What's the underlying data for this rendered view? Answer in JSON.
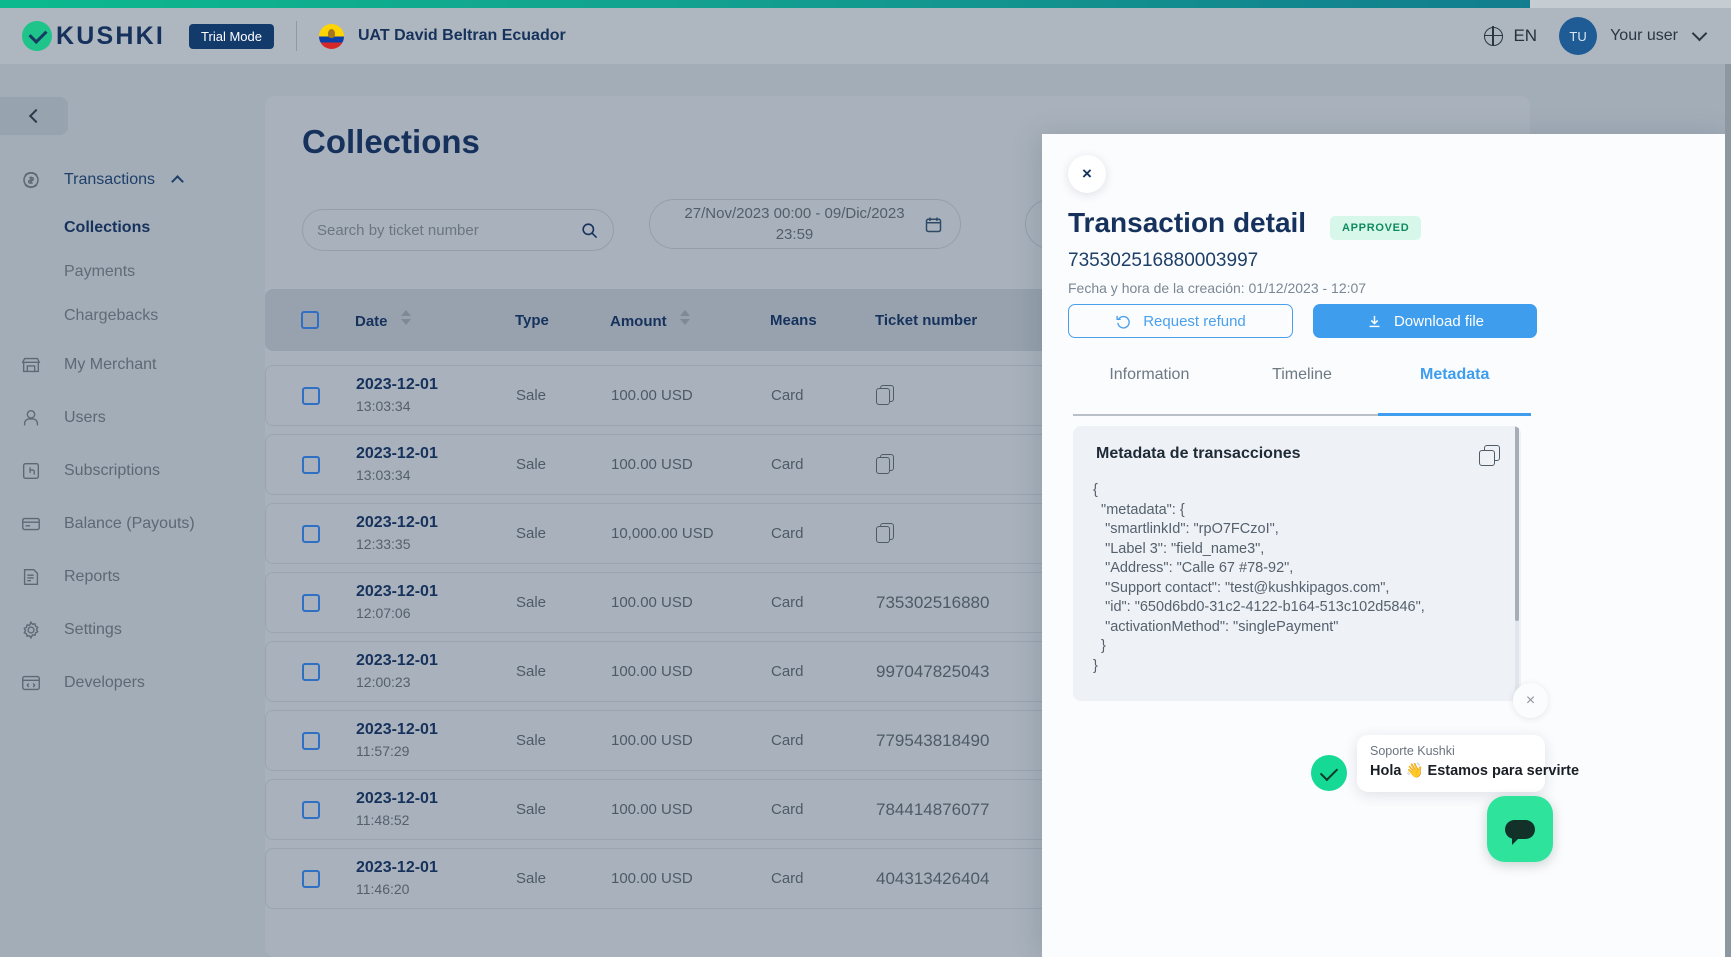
{
  "header": {
    "brand": "KUSHKI",
    "trial_badge": "Trial Mode",
    "merchant": "UAT David Beltran Ecuador",
    "language": "EN",
    "avatar_initials": "TU",
    "username": "Your user",
    "icons": {
      "globe": "globe-icon",
      "chevron": "chevron-down-icon"
    }
  },
  "sidebar": {
    "collapse": "collapse-sidebar",
    "items": [
      {
        "label": "Transactions",
        "icon": "dollar-refresh-icon",
        "expanded": true
      },
      {
        "label": "Collections",
        "sub": true,
        "active": true
      },
      {
        "label": "Payments",
        "sub": true,
        "active": false
      },
      {
        "label": "Chargebacks",
        "sub": true,
        "active": false
      },
      {
        "label": "My Merchant",
        "icon": "store-icon"
      },
      {
        "label": "Users",
        "icon": "user-icon"
      },
      {
        "label": "Subscriptions",
        "icon": "click-icon"
      },
      {
        "label": "Balance (Payouts)",
        "icon": "card-icon"
      },
      {
        "label": "Reports",
        "icon": "report-icon"
      },
      {
        "label": "Settings",
        "icon": "gear-icon"
      },
      {
        "label": "Developers",
        "icon": "code-icon"
      }
    ]
  },
  "page": {
    "title": "Collections",
    "search_placeholder": "Search by ticket number",
    "date_range": "27/Nov/2023 00:00 - 09/Dic/2023 23:59"
  },
  "table": {
    "columns": [
      "Date",
      "Type",
      "Amount",
      "Means",
      "Ticket number"
    ],
    "rows": [
      {
        "date": "2023-12-01",
        "time": "13:03:34",
        "type": "Sale",
        "amount": "100.00 USD",
        "means": "Card",
        "ticket": "",
        "copy": true
      },
      {
        "date": "2023-12-01",
        "time": "13:03:34",
        "type": "Sale",
        "amount": "100.00 USD",
        "means": "Card",
        "ticket": "",
        "copy": true
      },
      {
        "date": "2023-12-01",
        "time": "12:33:35",
        "type": "Sale",
        "amount": "10,000.00 USD",
        "means": "Card",
        "ticket": "",
        "copy": true
      },
      {
        "date": "2023-12-01",
        "time": "12:07:06",
        "type": "Sale",
        "amount": "100.00 USD",
        "means": "Card",
        "ticket": "735302516880",
        "copy": false
      },
      {
        "date": "2023-12-01",
        "time": "12:00:23",
        "type": "Sale",
        "amount": "100.00 USD",
        "means": "Card",
        "ticket": "997047825043",
        "copy": false
      },
      {
        "date": "2023-12-01",
        "time": "11:57:29",
        "type": "Sale",
        "amount": "100.00 USD",
        "means": "Card",
        "ticket": "779543818490",
        "copy": false
      },
      {
        "date": "2023-12-01",
        "time": "11:48:52",
        "type": "Sale",
        "amount": "100.00 USD",
        "means": "Card",
        "ticket": "784414876077",
        "copy": false
      },
      {
        "date": "2023-12-01",
        "time": "11:46:20",
        "type": "Sale",
        "amount": "100.00 USD",
        "means": "Card",
        "ticket": "404313426404",
        "copy": false
      }
    ]
  },
  "drawer": {
    "close": "×",
    "title": "Transaction detail",
    "status": "APPROVED",
    "ticket": "735302516880003997",
    "created": "Fecha y hora de la creación: 01/12/2023 - 12:07",
    "refund_label": "Request refund",
    "download_label": "Download file",
    "tabs": [
      {
        "label": "Information",
        "active": false
      },
      {
        "label": "Timeline",
        "active": false
      },
      {
        "label": "Metadata",
        "active": true
      }
    ],
    "metadata_title": "Metadata de transacciones",
    "metadata_json": "{\n  \"metadata\": {\n   \"smartlinkId\": \"rpO7FCzoI\",\n   \"Label 3\": \"field_name3\",\n   \"Address\": \"Calle 67 #78-92\",\n   \"Support contact\": \"test@kushkipagos.com\",\n   \"id\": \"650d6bd0-31c2-4122-b164-513c102d5846\",\n   \"activationMethod\": \"singlePayment\"\n  }\n}"
  },
  "chat": {
    "close": "×",
    "sender": "Soporte Kushki",
    "message": "Hola 👋 Estamos para servirte"
  },
  "colors": {
    "brand_green": "#1fc48a",
    "navy": "#16325c",
    "accent_blue": "#3f9ded",
    "status_green": "#108a62",
    "chat_green": "#2ee49c"
  }
}
